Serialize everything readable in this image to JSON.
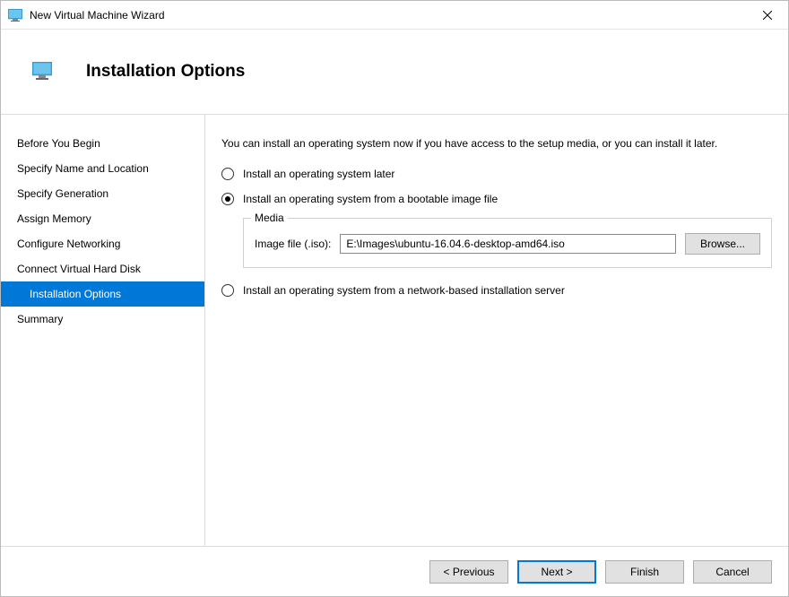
{
  "window": {
    "title": "New Virtual Machine Wizard"
  },
  "header": {
    "title": "Installation Options"
  },
  "sidebar": {
    "items": [
      {
        "label": "Before You Begin"
      },
      {
        "label": "Specify Name and Location"
      },
      {
        "label": "Specify Generation"
      },
      {
        "label": "Assign Memory"
      },
      {
        "label": "Configure Networking"
      },
      {
        "label": "Connect Virtual Hard Disk"
      },
      {
        "label": "Installation Options"
      },
      {
        "label": "Summary"
      }
    ],
    "selected_index": 6
  },
  "content": {
    "intro": "You can install an operating system now if you have access to the setup media, or you can install it later.",
    "options": {
      "later": "Install an operating system later",
      "bootable": "Install an operating system from a bootable image file",
      "network": "Install an operating system from a network-based installation server"
    },
    "selected_option": "bootable",
    "media": {
      "legend": "Media",
      "label": "Image file (.iso):",
      "path": "E:\\Images\\ubuntu-16.04.6-desktop-amd64.iso",
      "browse_label": "Browse..."
    }
  },
  "footer": {
    "previous": "< Previous",
    "next": "Next >",
    "finish": "Finish",
    "cancel": "Cancel"
  }
}
